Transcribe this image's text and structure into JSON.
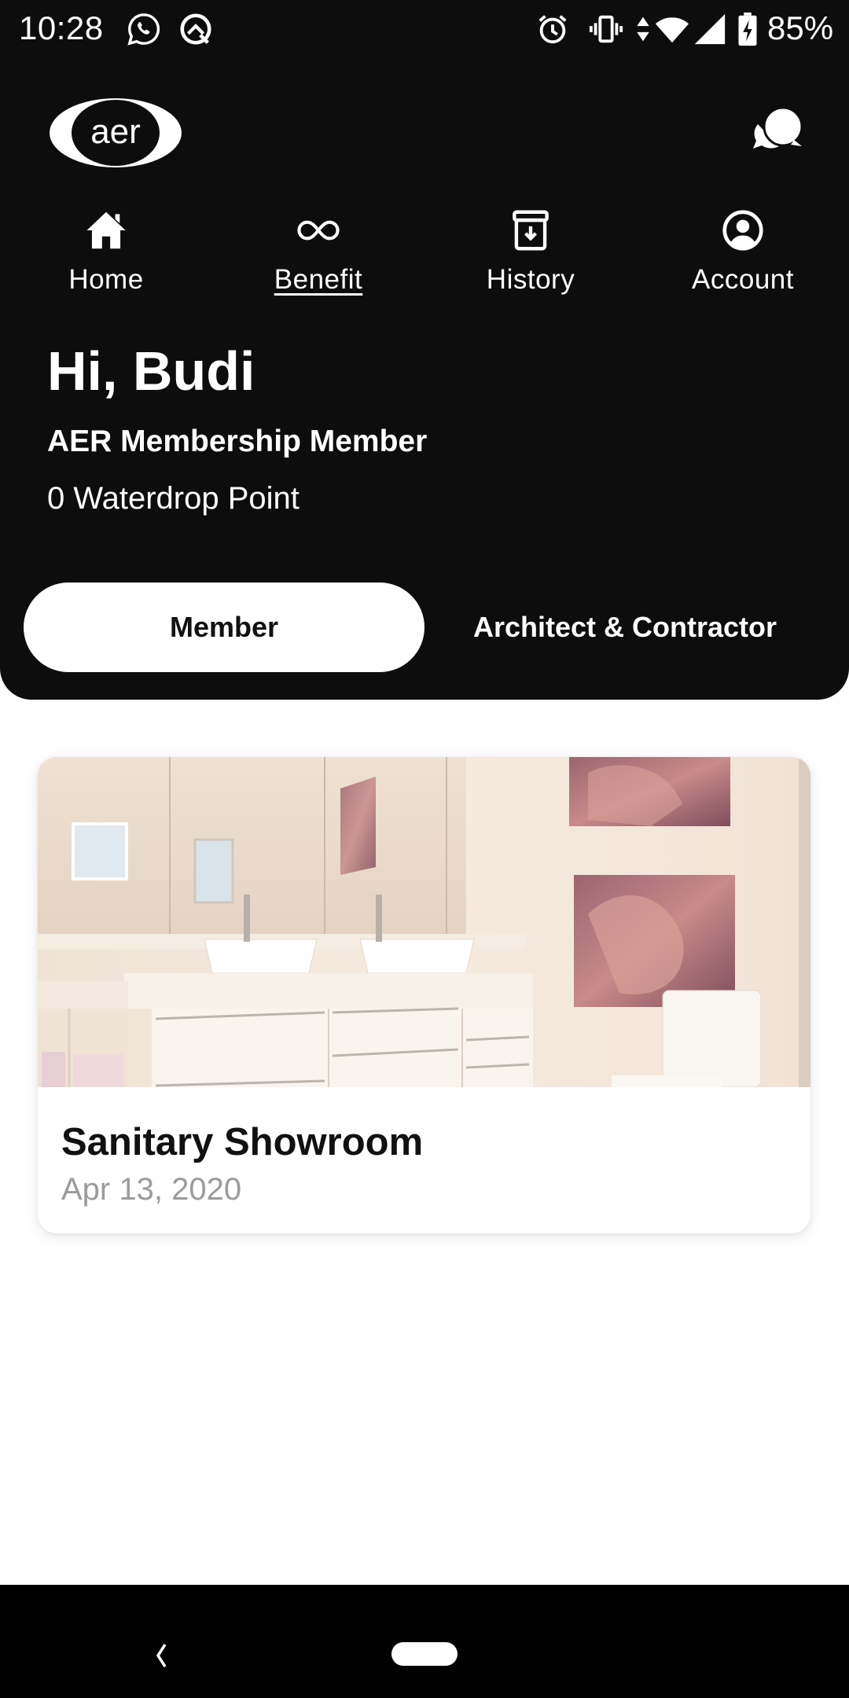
{
  "status_bar": {
    "time": "10:28",
    "left_icons": [
      "whatsapp-icon",
      "android-q-icon"
    ],
    "right_icons": [
      "alarm-icon",
      "vibrate-icon",
      "data-arrows-icon",
      "wifi-icon",
      "cell-signal-icon",
      "battery-charging-icon"
    ],
    "battery_percent": "85%"
  },
  "app_bar": {
    "logo_text": "aer",
    "chat_icon": "chat-bubbles-icon"
  },
  "nav": {
    "items": [
      {
        "label": "Home",
        "icon": "home-icon",
        "active": false
      },
      {
        "label": "Benefit",
        "icon": "infinity-icon",
        "active": true
      },
      {
        "label": "History",
        "icon": "archive-download-icon",
        "active": false
      },
      {
        "label": "Account",
        "icon": "account-circle-icon",
        "active": false
      }
    ]
  },
  "profile": {
    "greeting": "Hi, Budi",
    "membership": "AER Membership Member",
    "points": "0 Waterdrop Point"
  },
  "tabs": {
    "items": [
      {
        "label": "Member",
        "selected": true
      },
      {
        "label": "Architect & Contractor",
        "selected": false
      }
    ]
  },
  "benefits": [
    {
      "title": "Sanitary Showroom",
      "date": "Apr 13, 2020",
      "image": "bathroom-photo"
    }
  ],
  "system_nav": {
    "back_icon": "back-chevron-icon",
    "home_icon": "home-pill-icon"
  },
  "colors": {
    "header_bg": "#0d0d0d",
    "text_on_dark": "#ffffff",
    "selected_tab_bg": "#ffffff",
    "date_gray": "#9b9b9b",
    "card_bg": "#ffffff"
  }
}
